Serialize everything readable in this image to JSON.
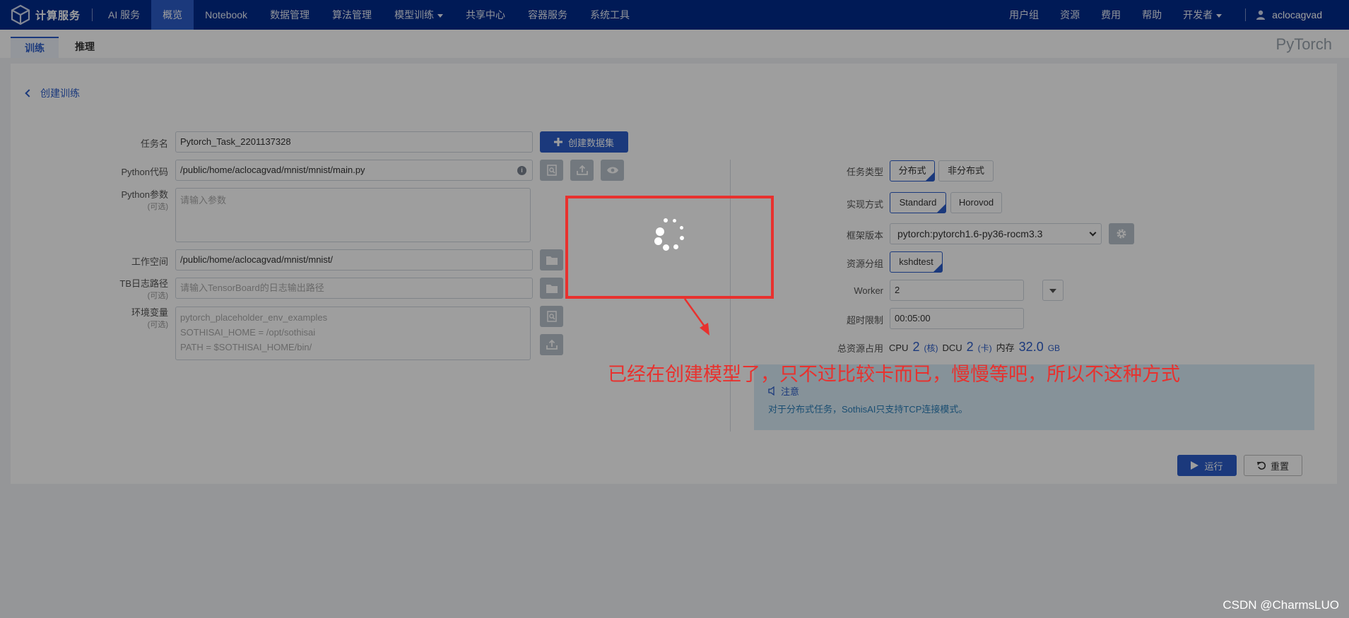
{
  "brand": {
    "name": "计算服务"
  },
  "nav": {
    "items": [
      {
        "label": "AI 服务"
      },
      {
        "label": "概览"
      },
      {
        "label": "Notebook"
      },
      {
        "label": "数据管理"
      },
      {
        "label": "算法管理"
      },
      {
        "label": "模型训练"
      },
      {
        "label": "共享中心"
      },
      {
        "label": "容器服务"
      },
      {
        "label": "系统工具"
      }
    ],
    "right": [
      {
        "label": "用户组"
      },
      {
        "label": "资源"
      },
      {
        "label": "费用"
      },
      {
        "label": "帮助"
      },
      {
        "label": "开发者"
      }
    ],
    "username": "aclocagvad"
  },
  "tabs": {
    "train": "训练",
    "infer": "推理"
  },
  "framework_label": "PyTorch",
  "back_label": "创建训练",
  "form": {
    "task_name": {
      "label": "任务名",
      "value": "Pytorch_Task_2201137328"
    },
    "create_dataset": "创建数据集",
    "python_code": {
      "label": "Python代码",
      "value": "/public/home/aclocagvad/mnist/mnist/main.py",
      "info": "i"
    },
    "python_params": {
      "label": "Python参数",
      "optional": "(可选)",
      "placeholder": "请输入参数"
    },
    "workspace": {
      "label": "工作空间",
      "value": "/public/home/aclocagvad/mnist/mnist/"
    },
    "tb_path": {
      "label": "TB日志路径",
      "optional": "(可选)",
      "placeholder": "请输入TensorBoard的日志输出路径"
    },
    "env": {
      "label": "环境变量",
      "optional": "(可选)",
      "line1": "pytorch_placeholder_env_examples",
      "line2": "SOTHISAI_HOME = /opt/sothisai",
      "line3": "PATH = $SOTHISAI_HOME/bin/"
    }
  },
  "right": {
    "task_type": {
      "label": "任务类型",
      "opt1": "分布式",
      "opt2": "非分布式"
    },
    "impl": {
      "label": "实现方式",
      "opt1": "Standard",
      "opt2": "Horovod"
    },
    "framework_ver": {
      "label": "框架版本",
      "value": "pytorch:pytorch1.6-py36-rocm3.3"
    },
    "res_group": {
      "label": "资源分组",
      "value": "kshdtest"
    },
    "worker": {
      "label": "Worker",
      "value": "2"
    },
    "timeout": {
      "label": "超时限制",
      "value": "00:05:00"
    },
    "total": {
      "label": "总资源占用",
      "cpu": "CPU",
      "cpu_n": "2",
      "cpu_u": "(核)",
      "dcu": "DCU",
      "dcu_n": "2",
      "dcu_u": "(卡)",
      "mem": "内存",
      "mem_n": "32.0",
      "mem_u": "GB"
    }
  },
  "notice": {
    "title": "注意",
    "text": "对于分布式任务，SothisAI只支持TCP连接模式。"
  },
  "buttons": {
    "run": "运行",
    "reset": "重置"
  },
  "annotation": "已经在创建模型了，只不过比较卡而已，慢慢等吧，所以不这种方式",
  "watermark": "CSDN @CharmsLUO"
}
